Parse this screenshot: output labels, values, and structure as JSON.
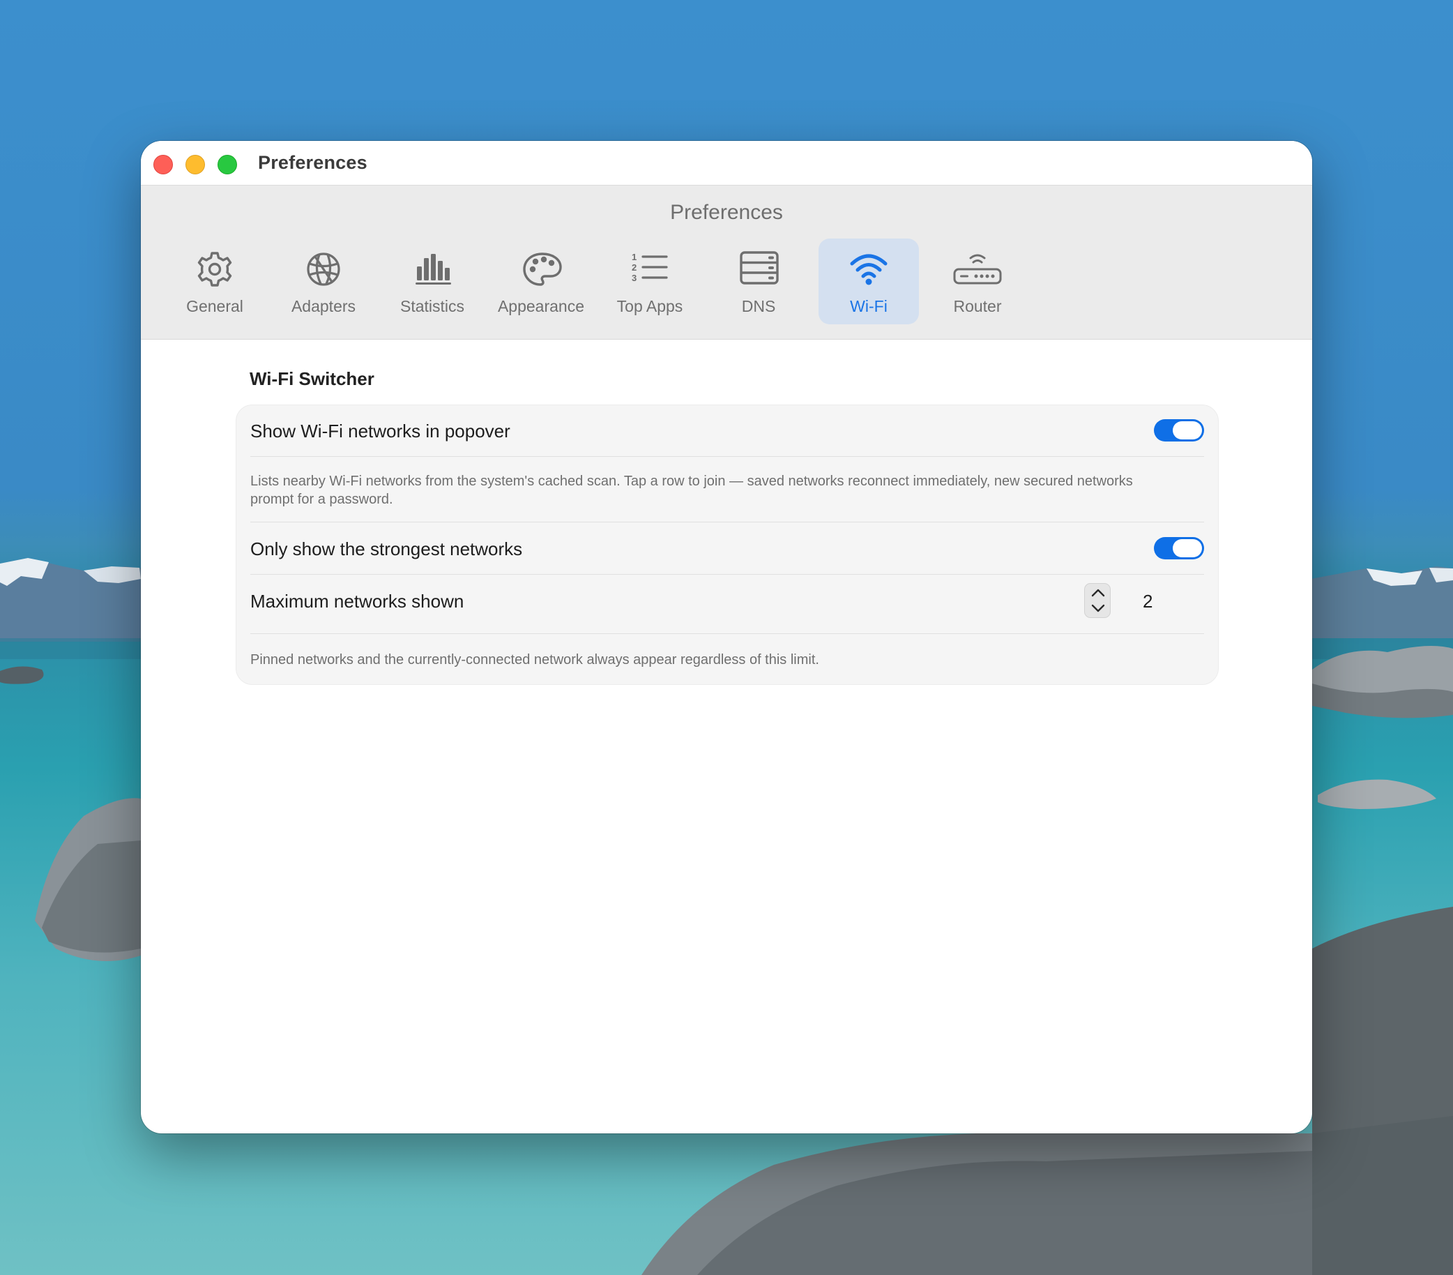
{
  "window": {
    "title": "Preferences"
  },
  "toolbar": {
    "title": "Preferences",
    "tabs": [
      {
        "label": "General",
        "icon": "gear-icon"
      },
      {
        "label": "Adapters",
        "icon": "globe-icon"
      },
      {
        "label": "Statistics",
        "icon": "bar-chart-icon"
      },
      {
        "label": "Appearance",
        "icon": "palette-icon"
      },
      {
        "label": "Top Apps",
        "icon": "numbered-list-icon"
      },
      {
        "label": "DNS",
        "icon": "server-icon"
      },
      {
        "label": "Wi-Fi",
        "icon": "wifi-icon",
        "selected": true
      },
      {
        "label": "Router",
        "icon": "router-icon"
      }
    ]
  },
  "wifi_switcher": {
    "section_title": "Wi-Fi Switcher",
    "show_networks_label": "Show Wi-Fi networks in popover",
    "show_networks_enabled": true,
    "show_networks_description": "Lists nearby Wi-Fi networks from the system's cached scan. Tap a row to join — saved networks reconnect immediately, new secured networks prompt for a password.",
    "strongest_label": "Only show the strongest networks",
    "strongest_enabled": true,
    "max_networks_label": "Maximum networks shown",
    "max_networks_value": "2",
    "max_networks_description": "Pinned networks and the currently-connected network always appear regardless of this limit."
  },
  "colors": {
    "accent": "#0f6fe6",
    "selected_tab_bg": "#d4e0f0",
    "close": "#fe5f57",
    "minimize": "#febc2e",
    "zoom": "#28c840"
  }
}
